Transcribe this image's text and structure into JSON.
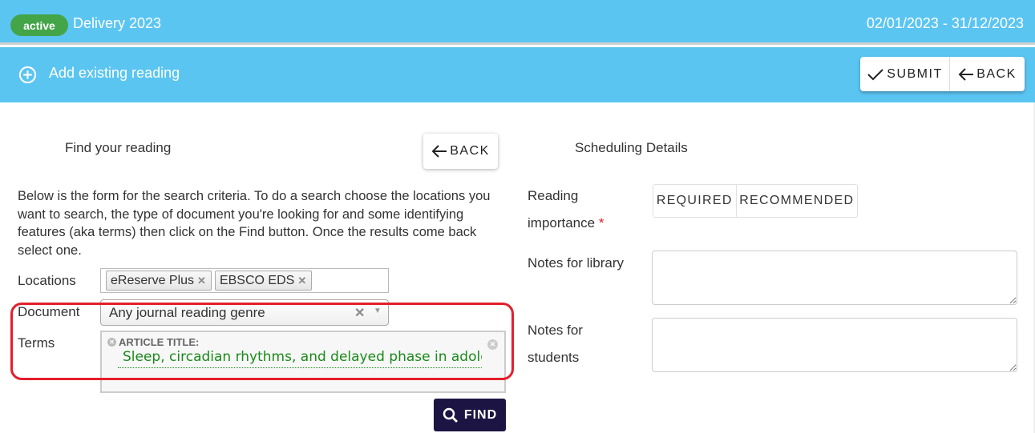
{
  "header": {
    "status_badge": "active",
    "title": "Delivery 2023",
    "date_range": "02/01/2023 - 31/12/2023"
  },
  "actionbar": {
    "icon": "add-circle-icon",
    "title": "Add existing reading",
    "submit_label": "SUBMIT",
    "back_label": "BACK"
  },
  "find": {
    "section_title": "Find your reading",
    "back_label": "BACK",
    "intro": "Below is the form for the search criteria. To do a search choose the locations you want to search, the type of document you're looking for and some identifying features (aka terms) then click on the Find button. Once the results come back select one.",
    "locations_label": "Locations",
    "locations": [
      {
        "label": "eReserve Plus"
      },
      {
        "label": "EBSCO EDS"
      }
    ],
    "document_label": "Document",
    "document_value": "Any journal reading genre",
    "terms_label": "Terms",
    "term": {
      "field_label": "ARTICLE TITLE:",
      "value": "Sleep, circadian rhythms, and delayed phase in adolescence"
    },
    "find_label": "FIND",
    "highlight_color": "#e41e2b"
  },
  "scheduling": {
    "section_title": "Scheduling Details",
    "importance_label_line1": "Reading",
    "importance_label_line2": "importance",
    "required_marker": "*",
    "importance_options": [
      "REQUIRED",
      "RECOMMENDED"
    ],
    "notes_library_label": "Notes for library",
    "notes_library_value": "",
    "notes_students_label_line1": "Notes for",
    "notes_students_label_line2": "students",
    "notes_students_value": ""
  },
  "colors": {
    "header_bg": "#5bc5f2",
    "badge_bg": "#43a548",
    "find_button_bg": "#1c1544",
    "term_text": "#1a8a1a"
  }
}
